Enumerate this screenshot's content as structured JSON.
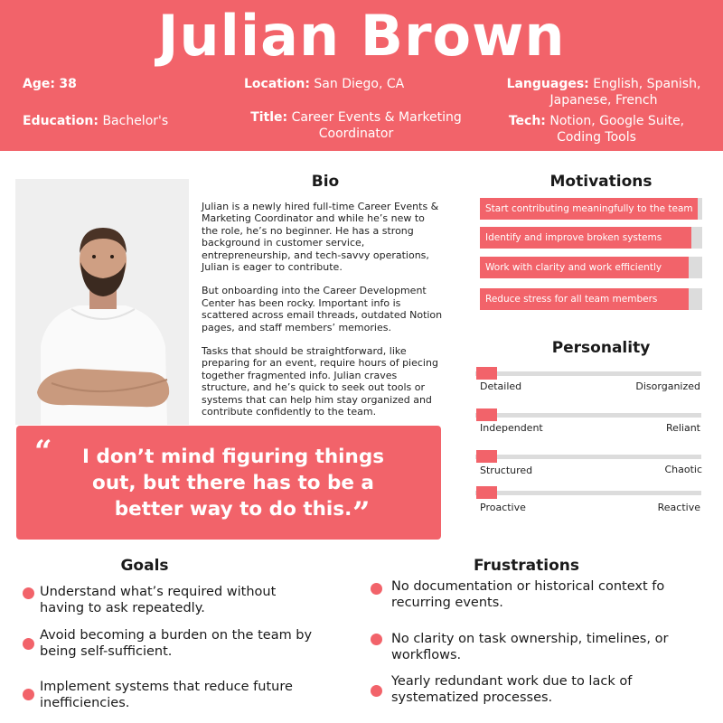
{
  "header": {
    "name": "Julian Brown",
    "age_label": "Age:",
    "age_value": "38",
    "location_label": "Location:",
    "location_value": "San Diego, CA",
    "languages_label": "Languages:",
    "languages_value_1": "English, Spanish,",
    "languages_value_2": "Japanese, French",
    "education_label": "Education:",
    "education_value": "Bachelor's",
    "title_label": "Title:",
    "title_value_1": "Career Events & Marketing",
    "title_value_2": "Coordinator",
    "tech_label": "Tech:",
    "tech_value_1": "Notion,  Google Suite,",
    "tech_value_2": "Coding Tools"
  },
  "bio": {
    "title": "Bio",
    "paragraphs": [
      "Julian is a newly hired full-time Career Events & Marketing Coordinator and while he’s new to the role, he’s no beginner. He has a strong background in customer service, entrepreneurship, and tech-savvy operations, Julian is eager to contribute.",
      "But onboarding into the Career Development Center has been rocky. Important info is scattered across email threads, outdated Notion pages, and staff members’ memories.",
      "Tasks that should be straightforward, like preparing for an event, require hours of piecing together fragmented info. Julian craves structure, and he’s quick to seek out tools or systems that can help him stay organized and contribute confidently to the team."
    ]
  },
  "quote": {
    "open_mark": "“",
    "text": "I don’t mind figuring things out, but there has to be a better way to do this.",
    "close_mark": "”"
  },
  "motivations": {
    "title": "Motivations",
    "items": [
      {
        "label": "Start contributing meaningfully to the team",
        "level": 0.98
      },
      {
        "label": "Identify and improve broken systems",
        "level": 0.95
      },
      {
        "label": "Work with clarity and work efficiently",
        "level": 0.94
      },
      {
        "label": "Reduce stress for all team members",
        "level": 0.94
      }
    ]
  },
  "personality": {
    "title": "Personality",
    "traits": [
      {
        "left": "Detailed",
        "right": "Disorganized",
        "position": 0.05
      },
      {
        "left": "Independent",
        "right": "Reliant",
        "position": 0.05
      },
      {
        "left": "Structured",
        "right": "Chaotic",
        "position": 0.05
      },
      {
        "left": "Proactive",
        "right": "Reactive",
        "position": 0.05
      }
    ]
  },
  "goals": {
    "title": "Goals",
    "items": [
      {
        "line1": "Understand what’s required without",
        "line2": "having to ask repeatedly."
      },
      {
        "line1": "Avoid becoming a burden on the team by",
        "line2": "being self-sufficient."
      },
      {
        "line1": "Implement systems that reduce future",
        "line2": "inefficiencies."
      }
    ]
  },
  "frustrations": {
    "title": "Frustrations",
    "items": [
      {
        "line1": "No documentation or historical context fo",
        "line2": "recurring events."
      },
      {
        "line1": "No clarity on task ownership, timelines, or",
        "line2": "workflows."
      },
      {
        "line1": "Yearly redundant work due to lack of",
        "line2": "systematized processes."
      }
    ]
  },
  "colors": {
    "accent": "#f2636a",
    "track": "#dcdcdc",
    "text": "#1a1a1a"
  }
}
